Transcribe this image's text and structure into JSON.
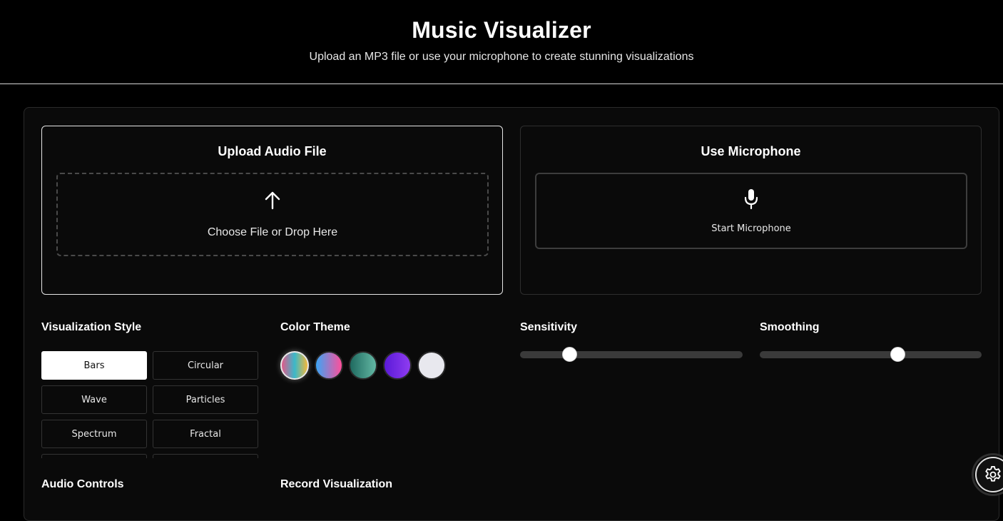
{
  "header": {
    "title": "Music Visualizer",
    "subtitle": "Upload an MP3 file or use your microphone to create stunning visualizations"
  },
  "upload": {
    "title": "Upload Audio File",
    "icon": "upload-arrow-icon",
    "label": "Choose File or Drop Here"
  },
  "microphone": {
    "title": "Use Microphone",
    "icon": "microphone-icon",
    "button_label": "Start Microphone"
  },
  "visualization_style": {
    "title": "Visualization Style",
    "options": [
      {
        "label": "Bars",
        "active": true
      },
      {
        "label": "Circular",
        "active": false
      },
      {
        "label": "Wave",
        "active": false
      },
      {
        "label": "Particles",
        "active": false
      },
      {
        "label": "Spectrum",
        "active": false
      },
      {
        "label": "Fractal",
        "active": false
      },
      {
        "label": "",
        "active": false
      },
      {
        "label": "",
        "active": false
      }
    ]
  },
  "color_theme": {
    "title": "Color Theme",
    "swatches": [
      {
        "name": "rainbow",
        "colors": [
          "#e05a8a",
          "#3bb8c9",
          "#f2b83b"
        ],
        "active": true
      },
      {
        "name": "neon",
        "colors": [
          "#3ba5f5",
          "#ff4f9a"
        ],
        "active": false
      },
      {
        "name": "ocean",
        "colors": [
          "#1f6a60",
          "#63b8a4"
        ],
        "active": false
      },
      {
        "name": "purple",
        "colors": [
          "#5a1ad8",
          "#8f3cf0"
        ],
        "active": false
      },
      {
        "name": "mono",
        "colors": [
          "#e8e8ee",
          "#e8e8ee"
        ],
        "active": false
      }
    ]
  },
  "sensitivity": {
    "title": "Sensitivity",
    "value": 0.22
  },
  "smoothing": {
    "title": "Smoothing",
    "value": 0.62
  },
  "audio_controls": {
    "title": "Audio Controls"
  },
  "record": {
    "title": "Record Visualization"
  },
  "settings": {
    "icon": "gear-icon"
  }
}
